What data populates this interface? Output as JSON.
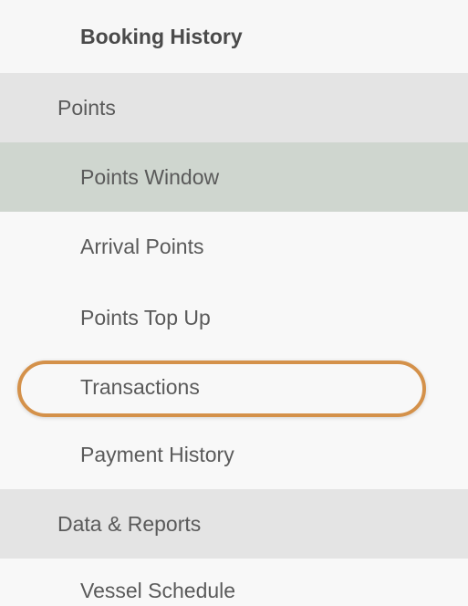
{
  "menu": {
    "items": [
      {
        "label": "Booking History"
      },
      {
        "label": "Points"
      },
      {
        "label": "Points Window"
      },
      {
        "label": "Arrival Points"
      },
      {
        "label": "Points Top Up"
      },
      {
        "label": "Transactions"
      },
      {
        "label": "Payment History"
      },
      {
        "label": "Data & Reports"
      },
      {
        "label": "Vessel Schedule"
      }
    ]
  },
  "colors": {
    "section_bg": "#e4e4e4",
    "selected_bg": "#cfd6cf",
    "item_bg": "#f8f8f8",
    "highlight_outline": "#d4914a"
  }
}
